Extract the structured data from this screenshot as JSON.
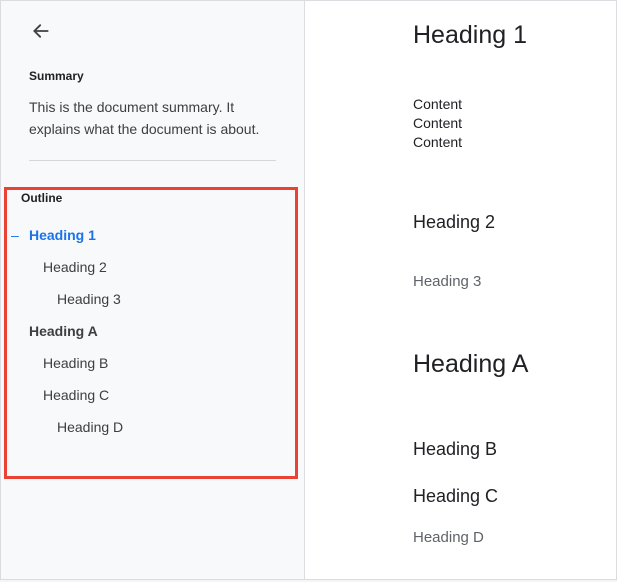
{
  "sidebar": {
    "summary_label": "Summary",
    "summary_text": "This is the document summary. It explains what the document is about.",
    "outline_label": "Outline",
    "outline_items": [
      {
        "label": "Heading 1",
        "level": 1,
        "active": true
      },
      {
        "label": "Heading 2",
        "level": 2,
        "active": false
      },
      {
        "label": "Heading 3",
        "level": 3,
        "active": false
      },
      {
        "label": "Heading A",
        "level": 1,
        "active": false
      },
      {
        "label": "Heading B",
        "level": 2,
        "active": false
      },
      {
        "label": "Heading C",
        "level": 2,
        "active": false
      },
      {
        "label": "Heading D",
        "level": 3,
        "active": false
      }
    ]
  },
  "document": {
    "h1": "Heading 1",
    "p_lines": "Content\nContent\nContent",
    "h2a": "Heading 2",
    "h3a": "Heading 3",
    "h1b": "Heading A",
    "h2b": "Heading B",
    "h2c": "Heading C",
    "h3b": "Heading D"
  }
}
